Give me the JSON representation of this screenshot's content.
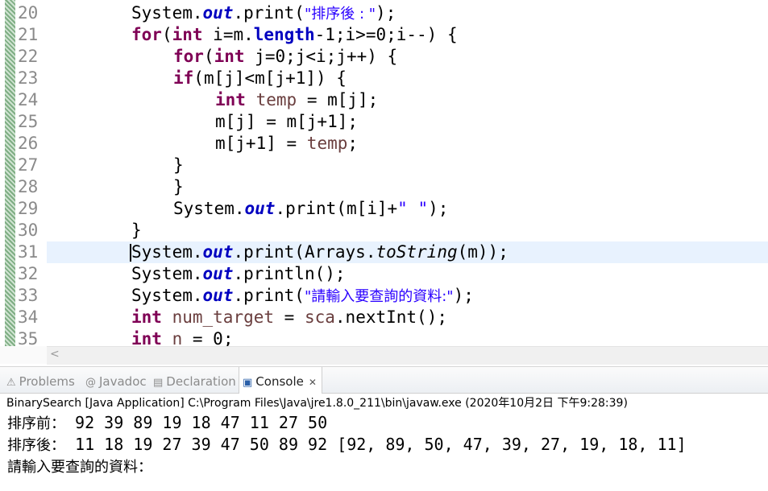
{
  "editor": {
    "line_numbers": [
      "20",
      "21",
      "22",
      "23",
      "24",
      "25",
      "26",
      "27",
      "28",
      "29",
      "30",
      "31",
      "32",
      "33",
      "34",
      "35"
    ],
    "current_line": "31",
    "lines": {
      "l20": {
        "a": "System.",
        "b": "out",
        "c": ".print(",
        "d": "\"排序後 : \"",
        "e": ");"
      },
      "l21": {
        "a": "for",
        "b": "(",
        "c": "int",
        "d": " i=m.",
        "e": "length",
        "f": "-1;i>=0;i--) {"
      },
      "l22": {
        "a": "for",
        "b": "(",
        "c": "int",
        "d": " j=0;j<i;j++) {"
      },
      "l23": {
        "a": "if",
        "b": "(m[j]<m[j+1]) {"
      },
      "l24": {
        "a": "int",
        "b": " ",
        "c": "temp",
        "d": " = m[j];"
      },
      "l25": {
        "a": "m[j] = m[j+1];"
      },
      "l26": {
        "a": "m[j+1] = ",
        "b": "temp",
        "c": ";"
      },
      "l27": {
        "a": "}"
      },
      "l28": {
        "a": "}"
      },
      "l29": {
        "a": "System.",
        "b": "out",
        "c": ".print(m[i]+",
        "d": "\" \"",
        "e": ");"
      },
      "l30": {
        "a": "}"
      },
      "l31": {
        "a": "System.",
        "b": "out",
        "c": ".print(Arrays.",
        "d": "toString",
        "e": "(m));"
      },
      "l32": {
        "a": "System.",
        "b": "out",
        "c": ".println();"
      },
      "l33": {
        "a": "System.",
        "b": "out",
        "c": ".print(",
        "d": "\"請輸入要查詢的資料:\"",
        "e": ");"
      },
      "l34": {
        "a": "int",
        "b": " ",
        "c": "num_target",
        "d": " = ",
        "e": "sca",
        "f": ".nextInt();"
      },
      "l35": {
        "a": "int",
        "b": " ",
        "c": "n",
        "d": " = 0;"
      }
    }
  },
  "scroll": {
    "left_arrow": "<"
  },
  "views": {
    "tabs": [
      {
        "icon": "problems-icon",
        "glyph": "⚠",
        "label": "Problems"
      },
      {
        "icon": "javadoc-icon",
        "glyph": "@",
        "label": "Javadoc"
      },
      {
        "icon": "declaration-icon",
        "glyph": "▤",
        "label": "Declaration"
      },
      {
        "icon": "console-icon",
        "glyph": "▣",
        "label": "Console",
        "close": "✕"
      }
    ]
  },
  "console": {
    "description": "BinarySearch [Java Application] C:\\Program Files\\Java\\jre1.8.0_211\\bin\\javaw.exe (2020年10月2日 下午9:28:39)",
    "line1_label": "排序前：",
    "line1_values": " 92 39 89 19 18 47 11 27 50",
    "line2_label": "排序後：",
    "line2_values": " 11 18 19 27 39 47 50 89 92 [92, 89, 50, 47, 39, 27, 19, 18, 11]",
    "line3_prompt": "請輸入要查詢的資料："
  },
  "colors": {
    "keyword": "#7f0055",
    "field": "#0000c0",
    "string": "#2a00ff",
    "local_var": "#6a3e3e",
    "current_line": "#e8f2fe"
  }
}
